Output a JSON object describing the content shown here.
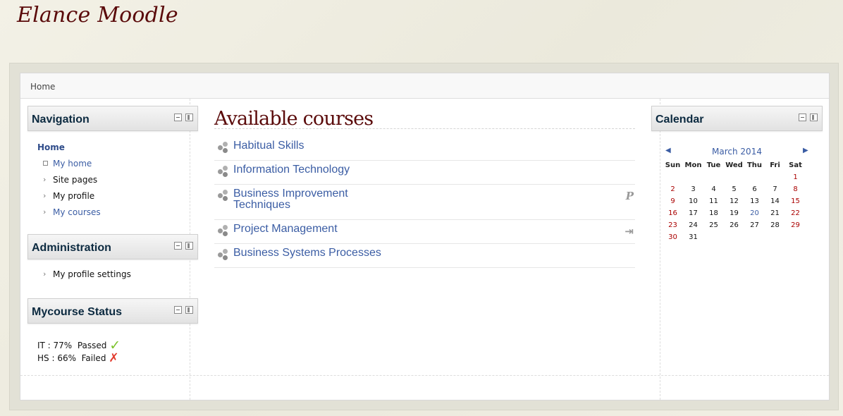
{
  "site": {
    "title": "Elance Moodle"
  },
  "navbar": {
    "breadcrumb": "Home"
  },
  "navigation": {
    "title": "Navigation",
    "home": "Home",
    "items": [
      {
        "label": "My home",
        "style": "link",
        "bullet": "square"
      },
      {
        "label": "Site pages",
        "style": "plain",
        "bullet": "arrow"
      },
      {
        "label": "My profile",
        "style": "plain",
        "bullet": "arrow"
      },
      {
        "label": "My courses",
        "style": "link",
        "bullet": "arrow"
      }
    ]
  },
  "administration": {
    "title": "Administration",
    "items": [
      {
        "label": "My profile settings"
      }
    ]
  },
  "mycourse_status": {
    "title": "Mycourse Status",
    "rows": [
      {
        "text": "IT : 77%  Passed",
        "result": "pass"
      },
      {
        "text": "HS : 66%  Failed",
        "result": "fail"
      }
    ]
  },
  "main": {
    "heading": "Available courses",
    "courses": [
      {
        "name": "Habitual Skills",
        "action": ""
      },
      {
        "name": "Information Technology",
        "action": ""
      },
      {
        "name": "Business Improvement Techniques",
        "action": "paypal-icon"
      },
      {
        "name": "Project Management",
        "action": "enrol-icon"
      },
      {
        "name": "Business Systems Processes",
        "action": ""
      }
    ]
  },
  "calendar": {
    "title": "Calendar",
    "month": "March 2014",
    "prev": "◀",
    "next": "▶",
    "weekdays": [
      "Sun",
      "Mon",
      "Tue",
      "Wed",
      "Thu",
      "Fri",
      "Sat"
    ],
    "weeks": [
      [
        "",
        "",
        "",
        "",
        "",
        "",
        "1"
      ],
      [
        "2",
        "3",
        "4",
        "5",
        "6",
        "7",
        "8"
      ],
      [
        "9",
        "10",
        "11",
        "12",
        "13",
        "14",
        "15"
      ],
      [
        "16",
        "17",
        "18",
        "19",
        "20",
        "21",
        "22"
      ],
      [
        "23",
        "24",
        "25",
        "26",
        "27",
        "28",
        "29"
      ],
      [
        "30",
        "31",
        "",
        "",
        "",
        "",
        ""
      ]
    ],
    "today": "20"
  },
  "colors": {
    "title": "#5a0a0a",
    "link": "#3b5da4",
    "weekend": "#aa0000",
    "pass": "#7cc22b",
    "fail": "#e23b2e"
  }
}
